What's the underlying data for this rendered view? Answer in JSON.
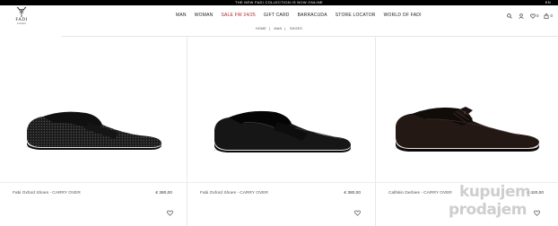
{
  "announcement": {
    "text": "THE NEW FADI COLLECTION IS NOW ONLINE",
    "lang": "EN"
  },
  "brand": {
    "name": "FADI",
    "tagline": "SHOES"
  },
  "nav": [
    {
      "label": "MAN",
      "color": "#222222"
    },
    {
      "label": "WOMAN",
      "color": "#222222"
    },
    {
      "label": "SALE FW 24/25",
      "color": "#b52020"
    },
    {
      "label": "GIFT CARD",
      "color": "#222222"
    },
    {
      "label": "BARRACUDA",
      "color": "#222222"
    },
    {
      "label": "STORE LOCATOR",
      "color": "#222222"
    },
    {
      "label": "WORLD OF FADI",
      "color": "#222222"
    }
  ],
  "header_icons": {
    "search": "search-icon",
    "account": "user-icon",
    "wishlist": "heart-icon",
    "wishlist_count": "0",
    "cart": "bag-icon",
    "cart_count": "0"
  },
  "breadcrumb": [
    "HOME",
    "MAN",
    "SHOES"
  ],
  "products": [
    {
      "title": "Fabi Oxford Shoes - CARRY OVER",
      "price": "€ 380,00"
    },
    {
      "title": "Fabi Oxford Shoes - CARRY OVER",
      "price": "€ 380,00"
    },
    {
      "title": "Calfskin Derbies - CARRY OVER",
      "price": "€ 420,00"
    }
  ],
  "watermark": {
    "line1": "kupujem",
    "line2": "prodajem"
  }
}
